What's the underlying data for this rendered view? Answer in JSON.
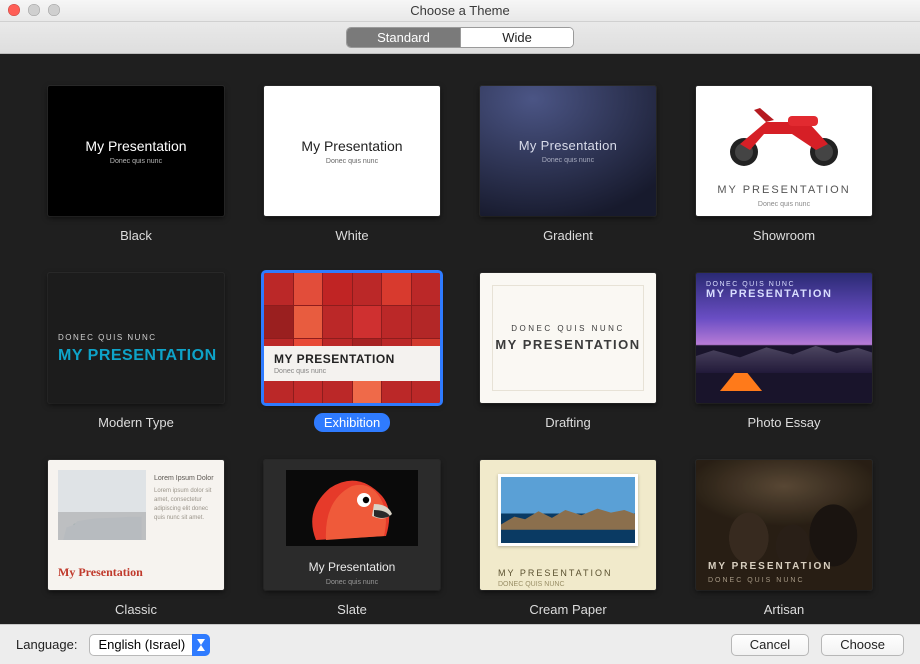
{
  "window": {
    "title": "Choose a Theme"
  },
  "tabs": {
    "standard": "Standard",
    "wide": "Wide",
    "active": "standard"
  },
  "thumb_text": {
    "mp": "My Presentation",
    "mp_upper": "MY PRESENTATION",
    "dqn": "Donec quis nunc",
    "dqn_upper": "DONEC QUIS NUNC",
    "lorem_head": "Lorem Ipsum Dolor",
    "lorem": "Lorem ipsum dolor sit amet, consectetur adipiscing elit donec quis nunc sit amet."
  },
  "themes": [
    {
      "id": "black",
      "name": "Black"
    },
    {
      "id": "white",
      "name": "White"
    },
    {
      "id": "gradient",
      "name": "Gradient"
    },
    {
      "id": "showroom",
      "name": "Showroom"
    },
    {
      "id": "modern",
      "name": "Modern Type"
    },
    {
      "id": "exhibition",
      "name": "Exhibition",
      "selected": true
    },
    {
      "id": "drafting",
      "name": "Drafting"
    },
    {
      "id": "photo",
      "name": "Photo Essay"
    },
    {
      "id": "classic",
      "name": "Classic"
    },
    {
      "id": "slate",
      "name": "Slate"
    },
    {
      "id": "cream",
      "name": "Cream Paper"
    },
    {
      "id": "artisan",
      "name": "Artisan"
    }
  ],
  "bottom": {
    "language_label": "Language:",
    "language_value": "English (Israel)",
    "cancel": "Cancel",
    "choose": "Choose"
  }
}
